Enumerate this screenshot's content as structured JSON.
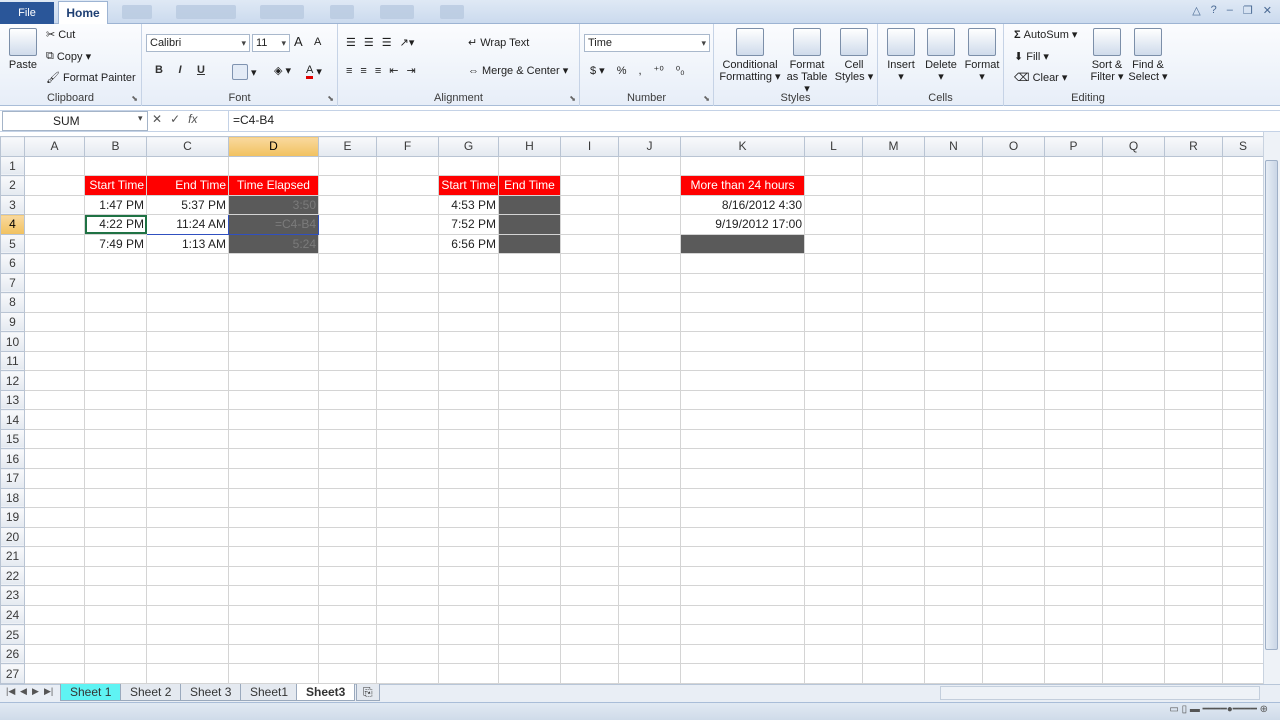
{
  "tabs": {
    "file": "File",
    "home": "Home"
  },
  "ribbon": {
    "clipboard": {
      "paste": "Paste",
      "cut": "Cut",
      "copy": "Copy ▾",
      "format_painter": "Format Painter",
      "label": "Clipboard"
    },
    "font": {
      "name": "Calibri",
      "size": "11",
      "bold": "B",
      "italic": "I",
      "underline": "U",
      "grow": "A",
      "shrink": "A",
      "label": "Font"
    },
    "alignment": {
      "wrap_text": "Wrap Text",
      "merge_center": "Merge & Center ▾",
      "label": "Alignment"
    },
    "number": {
      "format": "Time",
      "currency": "$ ▾",
      "percent": "%",
      "comma": ",",
      "label": "Number"
    },
    "styles": {
      "conditional": "Conditional",
      "conditional2": "Formatting ▾",
      "format_table": "Format",
      "format_table2": "as Table ▾",
      "cell_styles": "Cell",
      "cell_styles2": "Styles ▾",
      "label": "Styles"
    },
    "cells": {
      "insert": "Insert",
      "delete": "Delete",
      "format": "Format",
      "label": "Cells"
    },
    "editing": {
      "autosum": "AutoSum ▾",
      "fill": "Fill ▾",
      "clear": "Clear ▾",
      "sort": "Sort &",
      "sort2": "Filter ▾",
      "find": "Find &",
      "find2": "Select ▾",
      "label": "Editing"
    }
  },
  "formula_bar": {
    "name_box": "SUM",
    "formula": "=C4-B4"
  },
  "columns": [
    "A",
    "B",
    "C",
    "D",
    "E",
    "F",
    "G",
    "H",
    "I",
    "J",
    "K",
    "L",
    "M",
    "N",
    "O",
    "P",
    "Q",
    "R",
    "S"
  ],
  "rows": [
    "1",
    "2",
    "3",
    "4",
    "5",
    "6",
    "7",
    "8",
    "9",
    "10",
    "11",
    "12",
    "13",
    "14",
    "15",
    "16",
    "17",
    "18",
    "19",
    "20",
    "21",
    "22",
    "23",
    "24",
    "25",
    "26",
    "27"
  ],
  "cells": {
    "B2": "Start Time",
    "C2": "End Time",
    "D2": "Time Elapsed",
    "G2": "Start Time",
    "H2": "End Time",
    "K2": "More than 24 hours",
    "B3": "1:47 PM",
    "C3": "5:37 PM",
    "D3": "3:50",
    "B4": "4:22 PM",
    "C4": "11:24 AM",
    "D4": "=C4-B4",
    "B5": "7:49 PM",
    "C5": "1:13 AM",
    "D5": "5:24",
    "G3": "4:53 PM",
    "G4": "7:52 PM",
    "G5": "6:56 PM",
    "K3": "8/16/2012 4:30",
    "K4": "9/19/2012 17:00"
  },
  "sheet_tabs": [
    "Sheet 1",
    "Sheet 2",
    "Sheet 3",
    "Sheet1",
    "Sheet3"
  ]
}
